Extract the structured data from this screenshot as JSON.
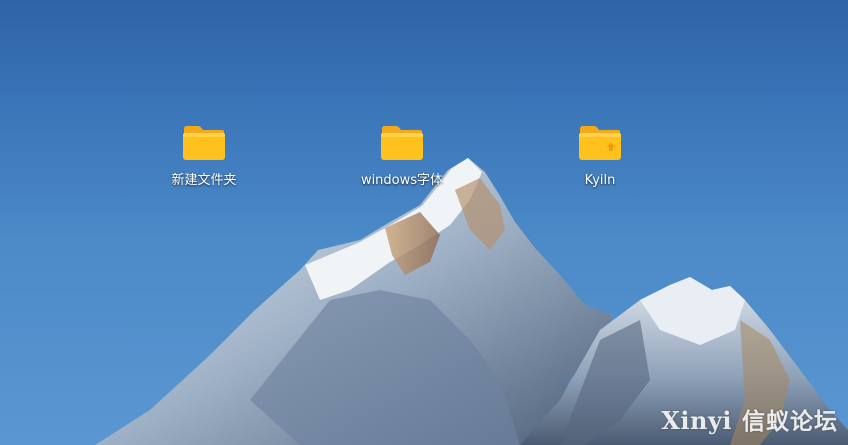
{
  "desktop": {
    "icons": [
      {
        "label": "新建文件夹",
        "icon": "folder-icon"
      },
      {
        "label": "windows字体",
        "icon": "folder-icon"
      },
      {
        "label": "Kyiln",
        "icon": "home-folder-icon"
      }
    ],
    "watermark": {
      "text_en": "Xinyi",
      "text_cn": "信蚁论坛"
    }
  },
  "colors": {
    "sky_top": "#2e64a6",
    "sky_bottom": "#5a97d2",
    "folder_yellow": "#ffc21c",
    "folder_tab": "#f3a91a",
    "home_badge": "#f39a12"
  }
}
